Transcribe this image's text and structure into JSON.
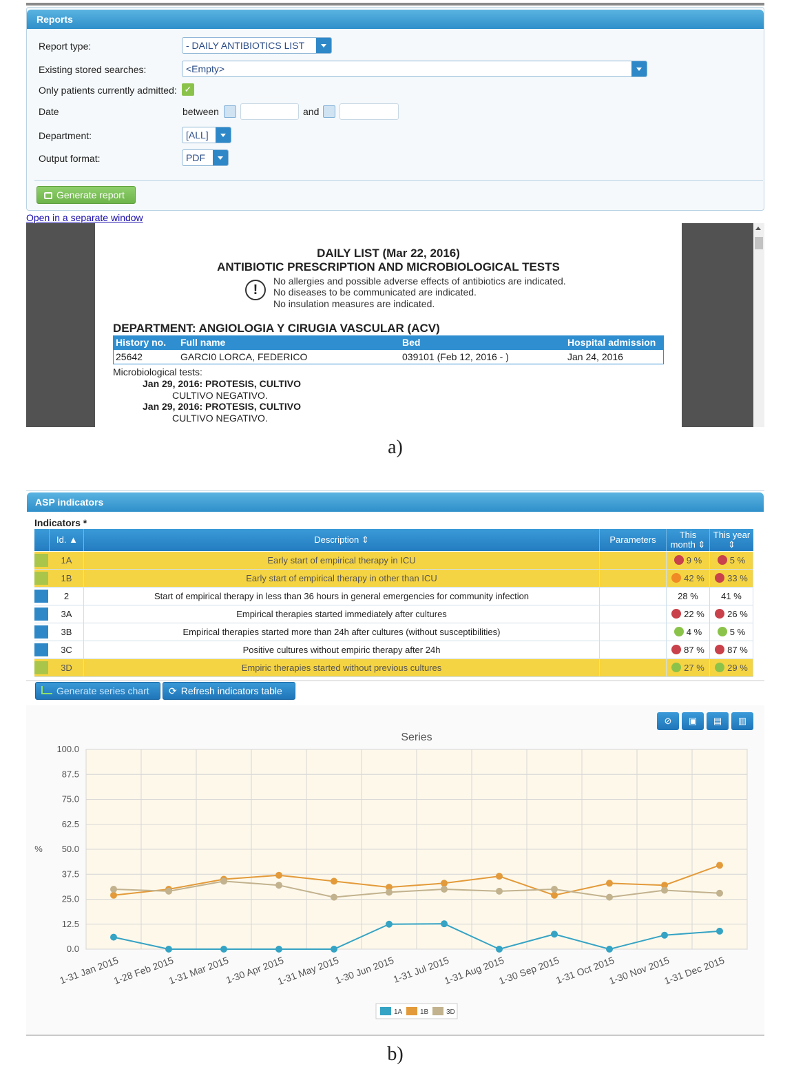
{
  "reports": {
    "panel_title": "Reports",
    "report_type_label": "Report type:",
    "report_type_value": "- DAILY ANTIBIOTICS LIST",
    "stored_searches_label": "Existing stored searches:",
    "stored_searches_value": "<Empty>",
    "only_admitted_label": "Only patients currently admitted:",
    "only_admitted_checked": "✓",
    "date_label": "Date",
    "between_label": "between",
    "and_label": "and",
    "department_label": "Department:",
    "department_value": "[ALL]",
    "output_format_label": "Output format:",
    "output_format_value": "PDF",
    "generate_button": "Generate report",
    "open_window_link": "Open in a separate window"
  },
  "document": {
    "title_line1": "DAILY LIST (Mar 22, 2016)",
    "title_line2": "ANTIBIOTIC PRESCRIPTION AND MICROBIOLOGICAL TESTS",
    "alert_icon_glyph": "!",
    "notes": [
      "No allergies and possible adverse effects of antibiotics are indicated.",
      "No diseases to be communicated are indicated.",
      "No insulation measures are indicated."
    ],
    "department": "DEPARTMENT: ANGIOLOGIA Y CIRUGIA VASCULAR (ACV)",
    "table_headers": [
      "History no.",
      "Full name",
      "Bed",
      "Hospital admission"
    ],
    "table_row": [
      "25642",
      "GARCI0 LORCA, FEDERICO",
      "039101 (Feb 12, 2016 - )",
      "Jan 24, 2016"
    ],
    "micro_label": "Microbiological tests:",
    "tests": [
      {
        "title": "Jan 29, 2016: PROTESIS, CULTIVO",
        "result": "CULTIVO NEGATIVO."
      },
      {
        "title": "Jan 29, 2016: PROTESIS, CULTIVO",
        "result": "CULTIVO NEGATIVO."
      }
    ]
  },
  "captions": {
    "a": "a)",
    "b": "b)"
  },
  "asp": {
    "panel_title": "ASP indicators",
    "indicators_label": "Indicators *",
    "headers": {
      "id": "Id. ▲",
      "description": "Description ⇕",
      "parameters": "Parameters",
      "this_month_1": "This",
      "this_month_2": "month ⇕",
      "this_year_1": "This year",
      "this_year_2": "⇕"
    },
    "rows": [
      {
        "id": "1A",
        "desc": "Early start of empirical therapy in ICU",
        "month": "9 %",
        "year": "5 %"
      },
      {
        "id": "1B",
        "desc": "Early start of empirical therapy in other than ICU",
        "month": "42 %",
        "year": "33 %"
      },
      {
        "id": "2",
        "desc": "Start of empirical therapy in less than 36 hours in general emergencies for community infection",
        "month": "28 %",
        "year": "41 %"
      },
      {
        "id": "3A",
        "desc": "Empirical therapies started immediately after cultures",
        "month": "22 %",
        "year": "26 %"
      },
      {
        "id": "3B",
        "desc": "Empirical therapies started more than 24h after cultures (without susceptibilities)",
        "month": "4 %",
        "year": "5 %"
      },
      {
        "id": "3C",
        "desc": "Positive cultures without empiric therapy after 24h",
        "month": "87 %",
        "year": "87 %"
      },
      {
        "id": "3D",
        "desc": "Empiric therapies started without previous cultures",
        "month": "27 %",
        "year": "29 %"
      }
    ],
    "colors": {
      "red": "#c9414a",
      "orange": "#f08a24",
      "green": "#8bc34a"
    },
    "generate_series_button": "Generate series chart",
    "refresh_button": "Refresh indicators table",
    "tool_icons": [
      "reset-icon",
      "image-export-icon",
      "excel-export-icon",
      "pdf-export-icon"
    ]
  },
  "chart_data": {
    "type": "line",
    "title": "Series",
    "ylabel": "%",
    "xlabel": "",
    "ylim": [
      0,
      100
    ],
    "yticks": [
      "100.0",
      "87.5",
      "75.0",
      "62.5",
      "50.0",
      "37.5",
      "25.0",
      "12.5",
      "0.0"
    ],
    "categories": [
      "1-31 Jan 2015",
      "1-28 Feb 2015",
      "1-31 Mar 2015",
      "1-30 Apr 2015",
      "1-31 May 2015",
      "1-30 Jun 2015",
      "1-31 Jul 2015",
      "1-31 Aug 2015",
      "1-30 Sep 2015",
      "1-31 Oct 2015",
      "1-30 Nov 2015",
      "1-31 Dec 2015"
    ],
    "series": [
      {
        "name": "1A",
        "color": "#35a3c4",
        "values": [
          6,
          0,
          0,
          0,
          0,
          12.5,
          12.7,
          0,
          7.5,
          0,
          7,
          9
        ]
      },
      {
        "name": "1B",
        "color": "#e39a3a",
        "values": [
          27,
          30,
          35,
          37,
          34,
          31,
          33,
          36.5,
          27,
          33,
          32,
          42
        ]
      },
      {
        "name": "3D",
        "color": "#c2b28e",
        "values": [
          30,
          29,
          34,
          32,
          26,
          28.5,
          30,
          29,
          30,
          26,
          29.5,
          28
        ]
      }
    ],
    "grid": true,
    "legend": "bottom-center"
  }
}
